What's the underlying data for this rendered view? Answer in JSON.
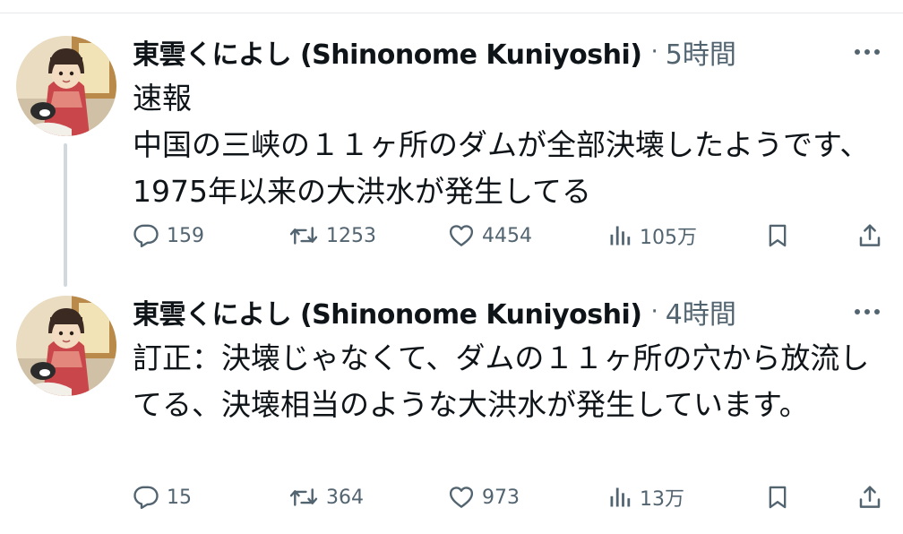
{
  "tweets": [
    {
      "display_name": "東雲くによし (Shinonome Kuniyoshi)",
      "separator": "·",
      "time": "5時間",
      "text": "速報\n中国の三峡の１１ヶ所のダムが全部決壊したようです、1975年以来の大洪水が発生してる",
      "replies": "159",
      "retweets": "1253",
      "likes": "4454",
      "views": "105万"
    },
    {
      "display_name": "東雲くによし (Shinonome Kuniyoshi)",
      "separator": "·",
      "time": "4時間",
      "text": "訂正：決壊じゃなくて、ダムの１１ヶ所の穴から放流してる、決壊相当のような大洪水が発生しています。",
      "replies": "15",
      "retweets": "364",
      "likes": "973",
      "views": "13万"
    }
  ],
  "icons": {
    "reply": "reply-icon",
    "retweet": "retweet-icon",
    "like": "heart-icon",
    "views": "views-chart-icon",
    "bookmark": "bookmark-icon",
    "share": "share-icon",
    "more": "more-dots-icon"
  },
  "colors": {
    "text": "#0f1419",
    "secondary": "#536471",
    "thread_line": "#cfd9de",
    "divider": "#e6e9ec"
  }
}
